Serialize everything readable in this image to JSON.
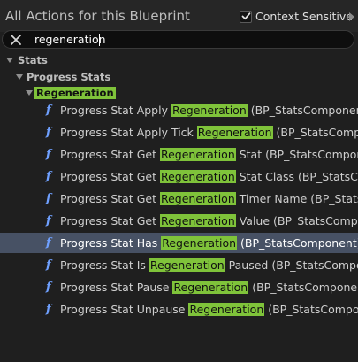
{
  "header": {
    "title": "All Actions for this Blueprint",
    "context_sensitive_label": "Context Sensitive",
    "context_sensitive_checked": true
  },
  "search": {
    "value": "regeneration"
  },
  "tree": {
    "categories": [
      {
        "label": "Stats"
      },
      {
        "label": "Progress Stats"
      },
      {
        "label": "Regeneration"
      }
    ],
    "items": [
      {
        "pre": "Progress Stat Apply ",
        "hl": "Regeneration",
        "post": " (BP_StatsComponent)"
      },
      {
        "pre": "Progress Stat Apply Tick ",
        "hl": "Regeneration",
        "post": " (BP_StatsCompone"
      },
      {
        "pre": "Progress Stat Get ",
        "hl": "Regeneration",
        "post": " Stat (BP_StatsComponent)"
      },
      {
        "pre": "Progress Stat Get ",
        "hl": "Regeneration",
        "post": " Stat Class (BP_StatsComp"
      },
      {
        "pre": "Progress Stat Get ",
        "hl": "Regeneration",
        "post": " Timer Name (BP_StatsCor"
      },
      {
        "pre": "Progress Stat Get ",
        "hl": "Regeneration",
        "post": " Value (BP_StatsCompone"
      },
      {
        "pre": "Progress Stat Has ",
        "hl": "Regeneration",
        "post": " (BP_StatsComponent)",
        "selected": true
      },
      {
        "pre": "Progress Stat Is ",
        "hl": "Regeneration",
        "post": " Paused (BP_StatsCompone"
      },
      {
        "pre": "Progress Stat Pause ",
        "hl": "Regeneration",
        "post": " (BP_StatsComponent)"
      },
      {
        "pre": "Progress Stat Unpause ",
        "hl": "Regeneration",
        "post": " (BP_StatsComponen"
      }
    ]
  },
  "colors": {
    "background": "#1f1f1f",
    "highlight": "#7fc33a",
    "selected_row": "#475164",
    "function_icon": "#6fa0ff"
  },
  "icons": {
    "function": "f",
    "clear_search": "close-icon",
    "checkbox": "checkmark-icon"
  }
}
